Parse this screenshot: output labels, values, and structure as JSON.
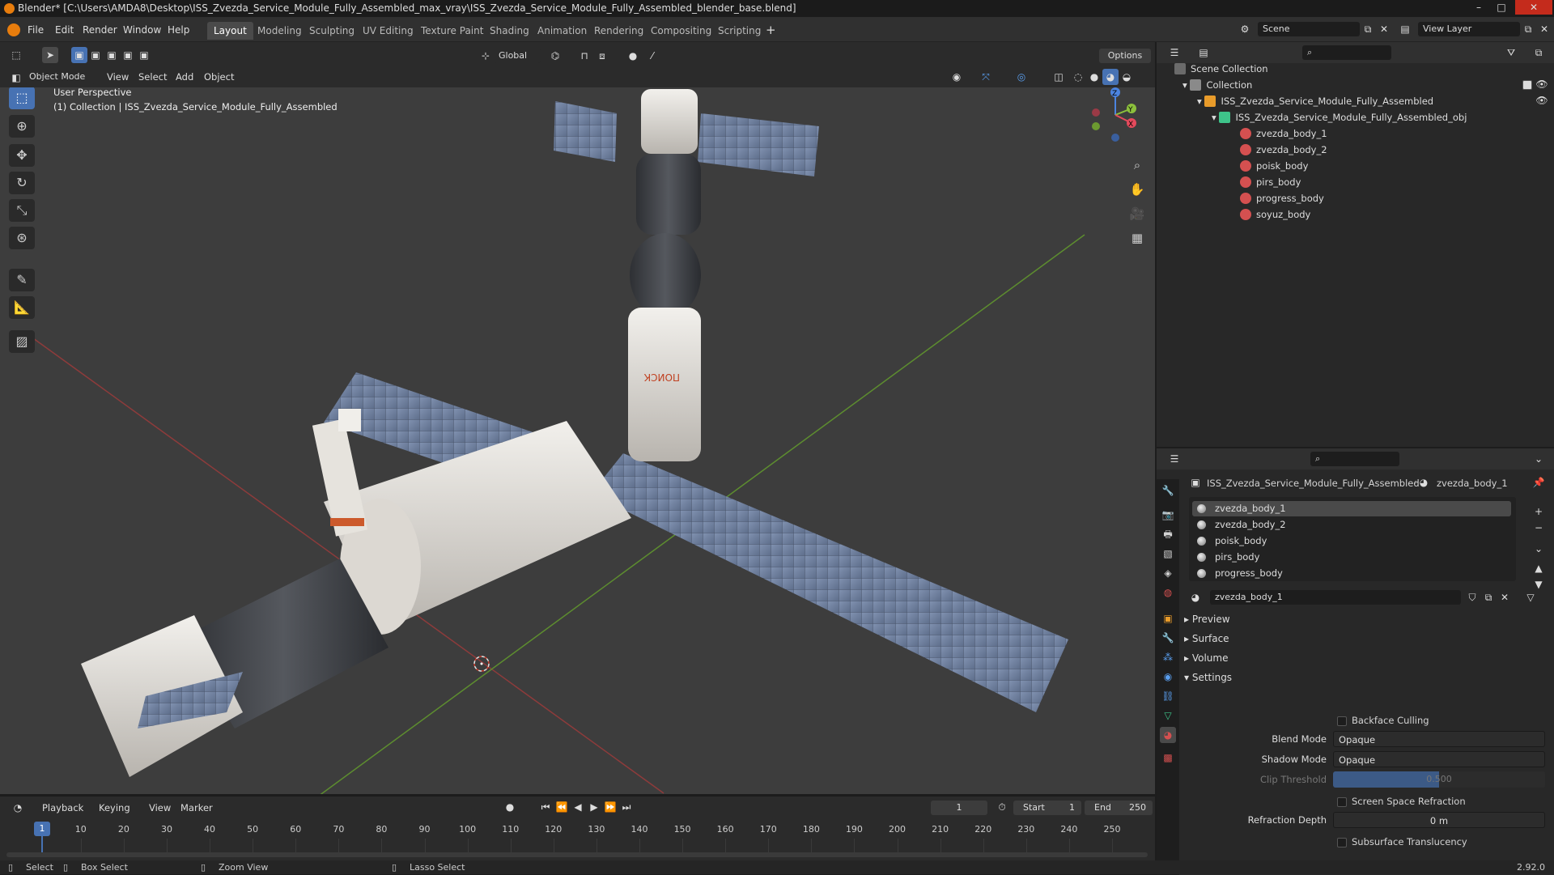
{
  "titlebar": {
    "text": "Blender* [C:\\Users\\AMDA8\\Desktop\\ISS_Zvezda_Service_Module_Fully_Assembled_max_vray\\ISS_Zvezda_Service_Module_Fully_Assembled_blender_base.blend]"
  },
  "menu": [
    "File",
    "Edit",
    "Render",
    "Window",
    "Help"
  ],
  "workspaces": [
    "Layout",
    "Modeling",
    "Sculpting",
    "UV Editing",
    "Texture Paint",
    "Shading",
    "Animation",
    "Rendering",
    "Compositing",
    "Scripting"
  ],
  "scene": {
    "name": "Scene",
    "view_layer": "View Layer"
  },
  "viewport": {
    "transform": "Global",
    "options": "Options",
    "mode": "Object Mode",
    "menu": [
      "View",
      "Select",
      "Add",
      "Object"
    ],
    "overlay_title": "User Perspective",
    "overlay_sub": "(1) Collection | ISS_Zvezda_Service_Module_Fully_Assembled",
    "decal_text": "ПОИСК",
    "gizmo": {
      "x": "X",
      "y": "Y",
      "z": "Z"
    }
  },
  "outliner": {
    "root": "Scene Collection",
    "collection": "Collection",
    "object": "ISS_Zvezda_Service_Module_Fully_Assembled",
    "mesh": "ISS_Zvezda_Service_Module_Fully_Assembled_obj",
    "materials": [
      "zvezda_body_1",
      "zvezda_body_2",
      "poisk_body",
      "pirs_body",
      "progress_body",
      "soyuz_body"
    ]
  },
  "properties": {
    "breadcrumb_object": "ISS_Zvezda_Service_Module_Fully_Assembled",
    "breadcrumb_material": "zvezda_body_1",
    "slots": [
      "zvezda_body_1",
      "zvezda_body_2",
      "poisk_body",
      "pirs_body",
      "progress_body"
    ],
    "material_name": "zvezda_body_1",
    "panels": [
      "Preview",
      "Surface",
      "Volume",
      "Settings"
    ],
    "backface_culling": "Backface Culling",
    "blend_mode_label": "Blend Mode",
    "blend_mode": "Opaque",
    "shadow_mode_label": "Shadow Mode",
    "shadow_mode": "Opaque",
    "clip_threshold_label": "Clip Threshold",
    "clip_threshold": "0.500",
    "ssr": "Screen Space Refraction",
    "refraction_depth_label": "Refraction Depth",
    "refraction_depth": "0 m",
    "sss": "Subsurface Translucency"
  },
  "timeline": {
    "menu": [
      "Playback",
      "Keying",
      "View",
      "Marker"
    ],
    "current": "1",
    "start_label": "Start",
    "start": "1",
    "end_label": "End",
    "end": "250",
    "ticks": [
      "1",
      "10",
      "20",
      "30",
      "40",
      "50",
      "60",
      "70",
      "80",
      "90",
      "100",
      "110",
      "120",
      "130",
      "140",
      "150",
      "160",
      "170",
      "180",
      "190",
      "200",
      "210",
      "220",
      "230",
      "240",
      "250"
    ]
  },
  "status": {
    "select": "Select",
    "box_select": "Box Select",
    "zoom_view": "Zoom View",
    "lasso_select": "Lasso Select",
    "version": "2.92.0"
  },
  "colors": {
    "accent": "#4772b3",
    "header": "#303030",
    "viewport": "#3d3d3d",
    "panel": "#282828"
  }
}
